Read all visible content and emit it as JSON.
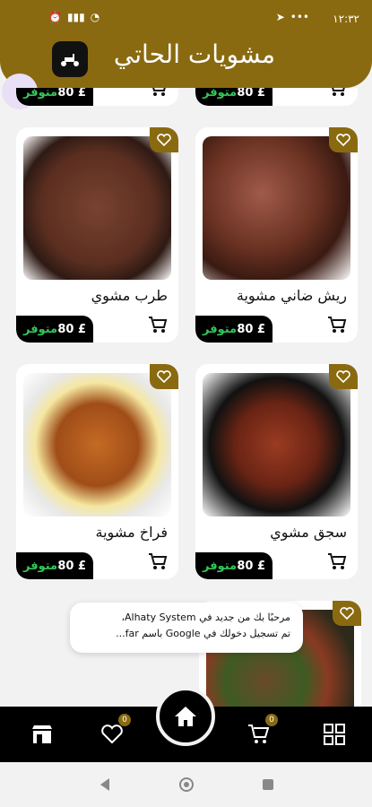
{
  "status": {
    "time": "١٢:٣٢"
  },
  "header": {
    "title": "مشويات الحاتي"
  },
  "products": [
    {
      "name": "",
      "price": "80 £",
      "availability": "متوفر"
    },
    {
      "name": "",
      "price": "80 £",
      "availability": "متوفر"
    },
    {
      "name": "ريش ضاني مشوية",
      "price": "80 £",
      "availability": "متوفر"
    },
    {
      "name": "طرب مشوي",
      "price": "80 £",
      "availability": "متوفر"
    },
    {
      "name": "سجق مشوي",
      "price": "80 £",
      "availability": "متوفر"
    },
    {
      "name": "فراخ مشوية",
      "price": "80 £",
      "availability": "متوفر"
    }
  ],
  "toast": {
    "line1": "مرحبًا بك من جديد في Alhaty System،",
    "line2": "تم تسجيل دخولك في Google باسم far..."
  },
  "bottom_nav": {
    "favorites_badge": "0",
    "cart_badge": "0"
  },
  "colors": {
    "accent": "#8a6a10",
    "available": "#34c759"
  }
}
